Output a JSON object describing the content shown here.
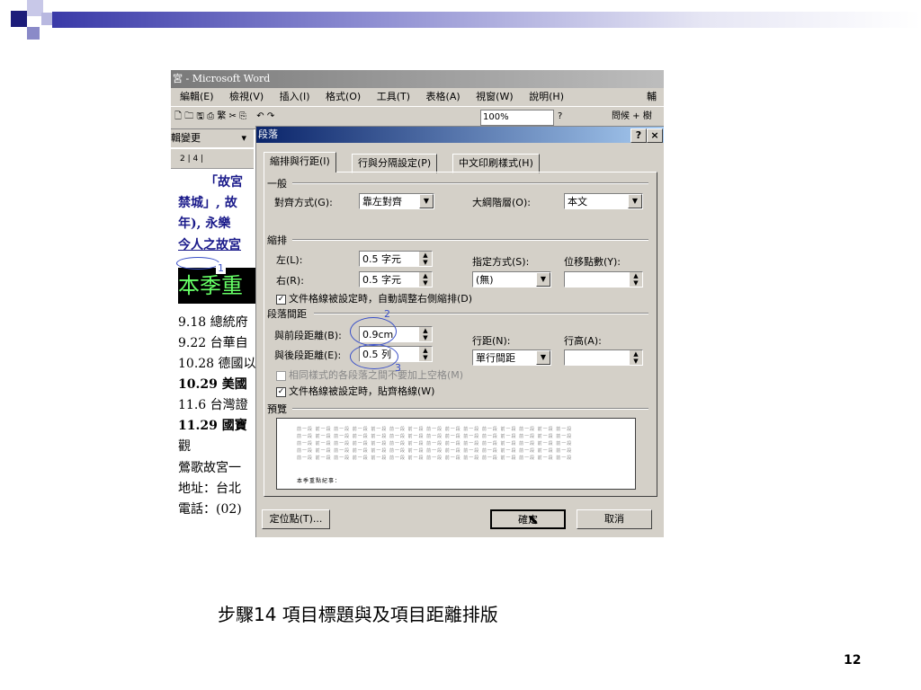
{
  "slide": {
    "caption": "步驟14 項目標題與及項目距離排版",
    "page_number": "12",
    "accent_color": "#3a3aa8"
  },
  "word": {
    "title": "宮 - Microsoft Word",
    "menu": [
      "編輯(E)",
      "檢視(V)",
      "插入(I)",
      "格式(O)",
      "工具(T)",
      "表格(A)",
      "視窗(W)",
      "說明(H)"
    ],
    "menu_right": "輔",
    "toolbar": {
      "zoom": "100%",
      "style_right": "問候 + 樹",
      "mixed": "繁"
    },
    "style_box": "輯變更",
    "ruler": "2 | 4 |",
    "doc_lines": [
      "「故宮",
      "禁城」, 故",
      "年), 永樂",
      "今人之故宮",
      "本季重",
      "9.18 總統府",
      "9.22 台華自",
      "10.28 德國以",
      "10.29 美國",
      "11.6 台灣證",
      "11.29 國寶",
      "觀",
      "鶯歌故宮一",
      "地址：台北",
      "電話：(02)"
    ]
  },
  "dialog": {
    "title": "段落",
    "help": "?",
    "close": "×",
    "tabs": [
      "縮排與行距(I)",
      "行與分隔設定(P)",
      "中文印刷樣式(H)"
    ],
    "general": {
      "section": "一般",
      "alignment_label": "對齊方式(G):",
      "alignment_value": "靠左對齊",
      "outline_label": "大綱階層(O):",
      "outline_value": "本文"
    },
    "indent": {
      "section": "縮排",
      "left_label": "左(L):",
      "left_value": "0.5 字元",
      "right_label": "右(R):",
      "right_value": "0.5 字元",
      "special_label": "指定方式(S):",
      "special_value": "(無)",
      "by_label": "位移點數(Y):",
      "by_value": "",
      "auto_adjust": "文件格線被設定時，自動調整右側縮排(D)"
    },
    "spacing": {
      "section": "段落間距",
      "before_label": "與前段距離(B):",
      "before_value": "0.9cm",
      "after_label": "與後段距離(E):",
      "after_value": "0.5 列",
      "line_spacing_label": "行距(N):",
      "line_spacing_value": "單行間距",
      "at_label": "行高(A):",
      "at_value": "",
      "no_space_same_style": "相同樣式的各段落之間不要加上空格(M)",
      "snap_to_grid": "文件格線被設定時，貼齊格線(W)"
    },
    "preview": {
      "section": "預覽",
      "sample_word": "前一段 前一段 前一段 前一段 前一段 前一段 前一段 前一段 前一段 前一段 前一段 前一段 前一段 前一段 前一段",
      "sample_text": "本季重點紀事："
    },
    "buttons": {
      "tabs": "定位點(T)...",
      "ok": "確定",
      "cancel": "取消"
    },
    "annotations": [
      "1",
      "2",
      "3"
    ]
  }
}
